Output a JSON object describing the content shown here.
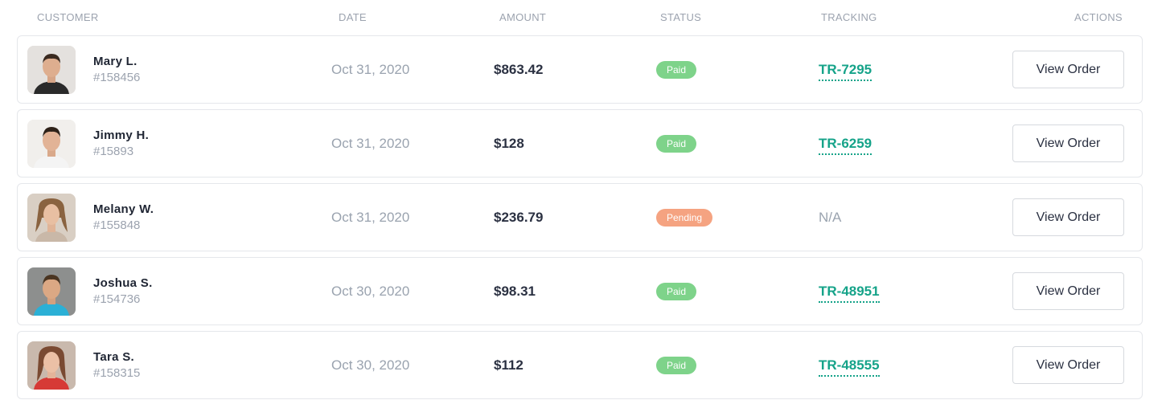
{
  "header": {
    "customer": "CUSTOMER",
    "date": "DATE",
    "amount": "AMOUNT",
    "status": "STATUS",
    "tracking": "TRACKING",
    "actions": "ACTIONS"
  },
  "colors": {
    "paid": "#7ed38a",
    "pending": "#f5a381",
    "tracking": "#15a389"
  },
  "rows": [
    {
      "name": "Mary L.",
      "id": "#158456",
      "date": "Oct 31, 2020",
      "amount": "$863.42",
      "status": "Paid",
      "tracking": "TR-7295",
      "action": "View Order"
    },
    {
      "name": "Jimmy H.",
      "id": "#15893",
      "date": "Oct 31, 2020",
      "amount": "$128",
      "status": "Paid",
      "tracking": "TR-6259",
      "action": "View Order"
    },
    {
      "name": "Melany W.",
      "id": "#155848",
      "date": "Oct 31, 2020",
      "amount": "$236.79",
      "status": "Pending",
      "tracking": "N/A",
      "action": "View Order"
    },
    {
      "name": "Joshua S.",
      "id": "#154736",
      "date": "Oct 30, 2020",
      "amount": "$98.31",
      "status": "Paid",
      "tracking": "TR-48951",
      "action": "View Order"
    },
    {
      "name": "Tara S.",
      "id": "#158315",
      "date": "Oct 30, 2020",
      "amount": "$112",
      "status": "Paid",
      "tracking": "TR-48555",
      "action": "View Order"
    }
  ]
}
